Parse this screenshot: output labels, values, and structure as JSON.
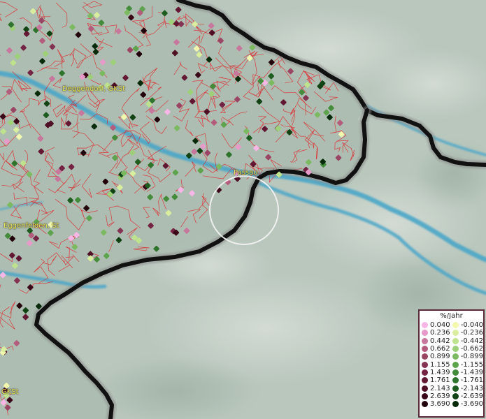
{
  "places": [
    {
      "id": "deggendorf",
      "name": "Deggendorf, GKSt"
    },
    {
      "id": "passau",
      "name": "Passau"
    },
    {
      "id": "eggenfelden",
      "name": "Eggenfelden, St"
    },
    {
      "id": "gksi",
      "name": "GKSt"
    }
  ],
  "legend": {
    "title": "%/Jahr",
    "positive": [
      {
        "label": "0.040",
        "color": "#f7b6e6"
      },
      {
        "label": "0.236",
        "color": "#e79ac9"
      },
      {
        "label": "0.442",
        "color": "#c8779c"
      },
      {
        "label": "0.662",
        "color": "#b35c7c"
      },
      {
        "label": "0.899",
        "color": "#9a4563"
      },
      {
        "label": "1.155",
        "color": "#853352"
      },
      {
        "label": "1.439",
        "color": "#742342"
      },
      {
        "label": "1.761",
        "color": "#621833"
      },
      {
        "label": "2.143",
        "color": "#4f0f25"
      },
      {
        "label": "2.639",
        "color": "#3a0718"
      },
      {
        "label": "3.690",
        "color": "#22020b"
      }
    ],
    "negative": [
      {
        "label": "-0.040",
        "color": "#f2f8ae"
      },
      {
        "label": "-0.236",
        "color": "#d8ee9e"
      },
      {
        "label": "-0.442",
        "color": "#bfe28c"
      },
      {
        "label": "-0.662",
        "color": "#9ed07a"
      },
      {
        "label": "-0.899",
        "color": "#7cba62"
      },
      {
        "label": "-1.155",
        "color": "#5ea34d"
      },
      {
        "label": "-1.439",
        "color": "#448b3b"
      },
      {
        "label": "-1.761",
        "color": "#2f742c"
      },
      {
        "label": "-2.143",
        "color": "#1e5c1f"
      },
      {
        "label": "-2.639",
        "color": "#124315"
      },
      {
        "label": "-3.690",
        "color": "#072a0a"
      }
    ]
  },
  "colors": {
    "border": "#111111",
    "border_glow": "#6a6a6a",
    "municipal_lines": "#e0262c",
    "river": "#4aa6c8",
    "terrain_dark": "#a9b8ad",
    "terrain_light": "#c8d4cb",
    "label": "#e8e25a",
    "circle": "#f4f4f4"
  },
  "icons": {
    "highlight": "highlight-circle",
    "sample_point": "diamond-marker"
  }
}
